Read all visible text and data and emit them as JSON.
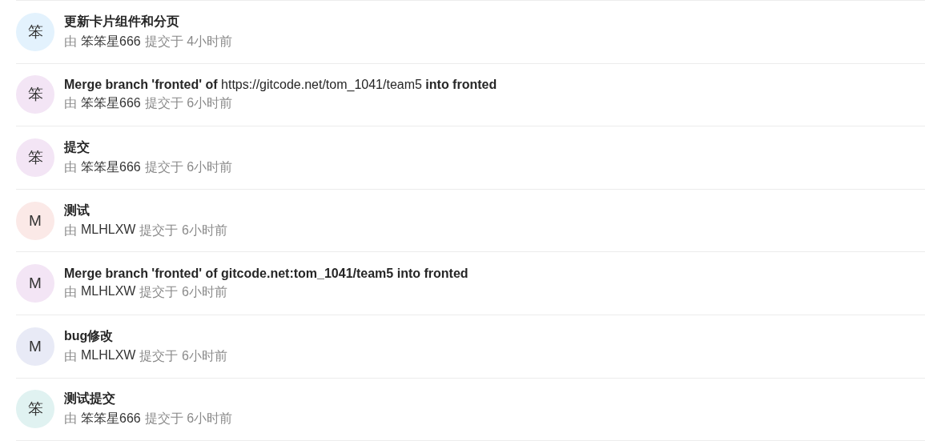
{
  "commits": [
    {
      "avatar": "笨",
      "color": "#e3f2fd",
      "kind": "plain",
      "title": "更新卡片组件和分页",
      "prefix": "由",
      "author": "笨笨星666",
      "action": "提交于 4小时前"
    },
    {
      "avatar": "笨",
      "color": "#f3e5f5",
      "kind": "marked",
      "title": "**Merge branch 'fronted' of** https://gitcode.net/tom_1041/team5 **into fronted**",
      "prefix": "由",
      "author": "笨笨星666",
      "action": "提交于 6小时前"
    },
    {
      "avatar": "笨",
      "color": "#f3e5f5",
      "kind": "plain",
      "title": "提交",
      "prefix": "由",
      "author": "笨笨星666",
      "action": "提交于 6小时前"
    },
    {
      "avatar": "M",
      "color": "#fbe9e7",
      "kind": "plain",
      "title": "测试",
      "prefix": "由",
      "author": "MLHLXW",
      "action": "提交于 6小时前"
    },
    {
      "avatar": "M",
      "color": "#f3e5f5",
      "kind": "plain",
      "title": "Merge branch 'fronted' of gitcode.net:tom_1041/team5 into fronted",
      "prefix": "由",
      "author": "MLHLXW",
      "action": "提交于 6小时前"
    },
    {
      "avatar": "M",
      "color": "#e8eaf6",
      "kind": "plain",
      "title": "bug修改",
      "prefix": "由",
      "author": "MLHLXW",
      "action": "提交于 6小时前"
    },
    {
      "avatar": "笨",
      "color": "#e0f2f1",
      "kind": "plain",
      "title": "测试提交",
      "prefix": "由",
      "author": "笨笨星666",
      "action": "提交于 6小时前"
    }
  ]
}
